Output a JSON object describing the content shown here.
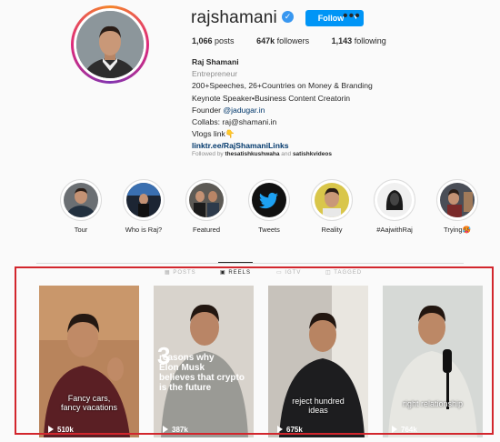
{
  "profile": {
    "username": "rajshamani",
    "follow_label": "Follow",
    "more_label": "•••",
    "posts_count": "1,066",
    "posts_label": "posts",
    "followers_count": "647k",
    "followers_label": "followers",
    "following_count": "1,143",
    "following_label": "following",
    "name": "Raj Shamani",
    "category": "Entrepreneur",
    "bio_line1": "200+Speeches, 26+Countries on Money & Branding",
    "bio_line2": "Keynote Speaker•Business Content Creatorin",
    "founder_prefix": "Founder ",
    "founder_handle": "@jadugar.in",
    "collabs": "Collabs: raj@shamani.in",
    "vlogs": "Vlogs link👇",
    "website": "linktr.ee/RajShamaniLinks",
    "followed_prefix": "Followed by ",
    "followed_user1": "thesatishkushwaha",
    "followed_and": " and ",
    "followed_user2": "satishkvideos"
  },
  "highlights": [
    {
      "label": "Tour"
    },
    {
      "label": "Who is Raj?"
    },
    {
      "label": "Featured"
    },
    {
      "label": "Tweets"
    },
    {
      "label": "Reality"
    },
    {
      "label": "#AajwithRaj"
    },
    {
      "label": "Trying🥵"
    }
  ],
  "tabs": [
    {
      "label": "POSTS"
    },
    {
      "label": "REELS"
    },
    {
      "label": "IGTV"
    },
    {
      "label": "TAGGED"
    }
  ],
  "reels": [
    {
      "caption": "Fancy cars,\nfancy vacations",
      "views": "510k"
    },
    {
      "caption_big": "3",
      "caption": "reasons why\nElon Musk\nbelieves that crypto\nis the future",
      "views": "387k"
    },
    {
      "caption": "reject hundred\nideas",
      "views": "675k"
    },
    {
      "caption": "right relationship",
      "views": "764k"
    }
  ],
  "colors": {
    "accent": "#0095f6",
    "highlight_box": "#d2262d"
  }
}
